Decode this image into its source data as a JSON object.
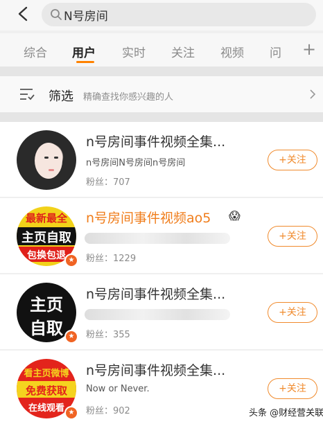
{
  "search": {
    "query": "N号房间"
  },
  "tabs": [
    "综合",
    "用户",
    "实时",
    "关注",
    "视频",
    "问"
  ],
  "active_tab": "用户",
  "filter": {
    "label": "筛选",
    "description": "精确查找你感兴趣的人"
  },
  "users": [
    {
      "name": "n号房间事件视频全集...",
      "description": "n号房间N号房间n号房间",
      "fans": "粉丝：707",
      "follow_label": "+关注"
    },
    {
      "name": "n号房间事件视频ao5",
      "description": "",
      "fans": "粉丝：1229",
      "follow_label": "+关注",
      "avatar_lines": [
        "最新最全",
        "主页自取",
        "包换包退"
      ]
    },
    {
      "name": "n号房间事件视频全集...",
      "description": "",
      "fans": "粉丝：355",
      "follow_label": "+关注",
      "avatar_lines": [
        "主页",
        "自取"
      ]
    },
    {
      "name": "n号房间事件视频全集...",
      "description": "Now or Never.",
      "fans": "粉丝：902",
      "follow_label": "+关注",
      "avatar_lines": [
        "看主页微博",
        "免费获取",
        "在线观看"
      ]
    }
  ],
  "watermark": "头条 @财经营关联",
  "colors": {
    "accent": "#ff8200",
    "follow": "#f08a2c",
    "orange_name": "#f07d1b",
    "verified_badge": "#f06323"
  }
}
